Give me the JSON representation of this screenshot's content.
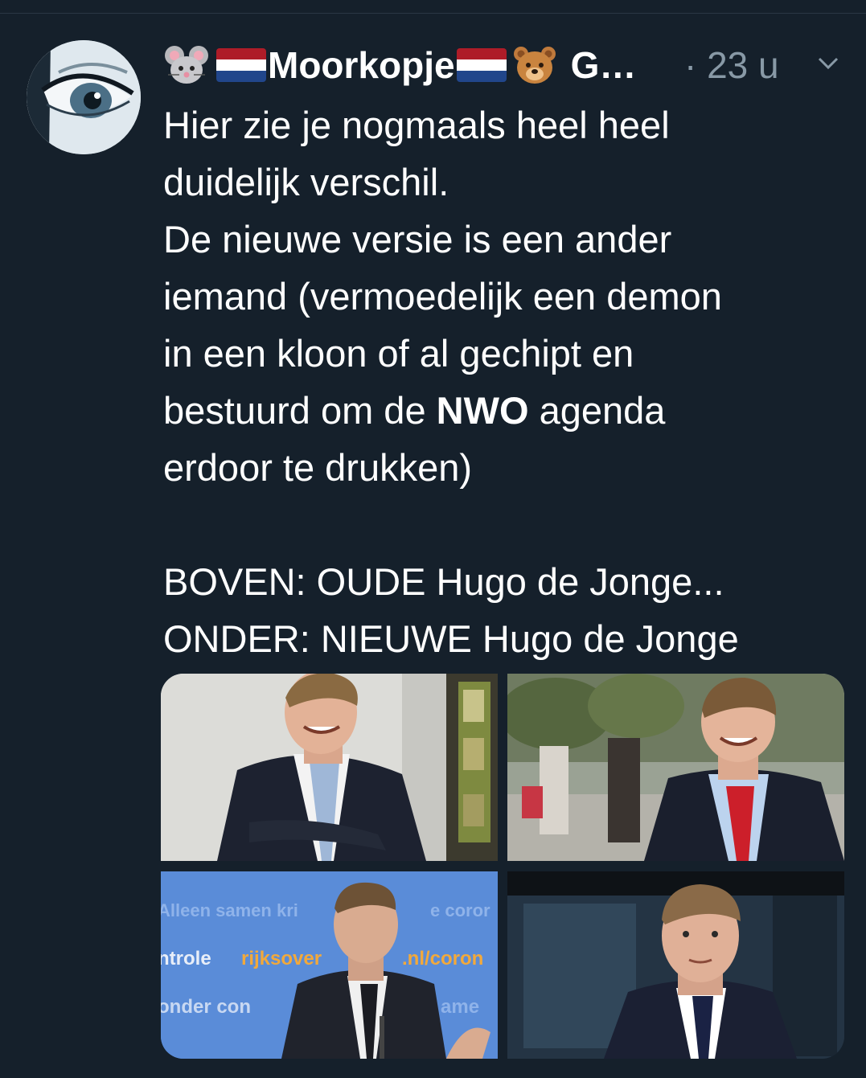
{
  "tweet": {
    "author_name": "Moorkopje",
    "author_name_truncated": "G…",
    "timestamp": "· 23 u",
    "text_lines": [
      "Hier zie je nogmaals heel heel",
      "duidelijk verschil.",
      "De nieuwe versie is een ander",
      "iemand (vermoedelijk een demon",
      "in een kloon of al gechipt en"
    ],
    "text_line6_before": "bestuurd om de ",
    "text_line6_bold": "NWO",
    "text_line6_after": " agenda",
    "text_line7": "erdoor te drukken)",
    "text_line9": "BOVEN: OUDE Hugo de Jonge...",
    "text_line10": "ONDER: NIEUWE Hugo de Jonge"
  },
  "media": {
    "photo3_text_line1": "Alleen samen kri",
    "photo3_text_line1b": "e coror",
    "photo3_text_line2a": "ntrole",
    "photo3_text_line2b": "rijksover",
    "photo3_text_line2c": ".nl/coron",
    "photo3_text_line3": "onder con",
    "photo3_text_line3b": "ame"
  },
  "colors": {
    "background": "#15202b",
    "text_primary": "#ffffff",
    "text_secondary": "#8899a6",
    "flag_red": "#ae1c28",
    "flag_white": "#ffffff",
    "flag_blue": "#21468b"
  },
  "icons": [
    "mouse-emoji-icon",
    "dutch-flag-icon",
    "bear-emoji-icon",
    "chevron-down-icon"
  ]
}
